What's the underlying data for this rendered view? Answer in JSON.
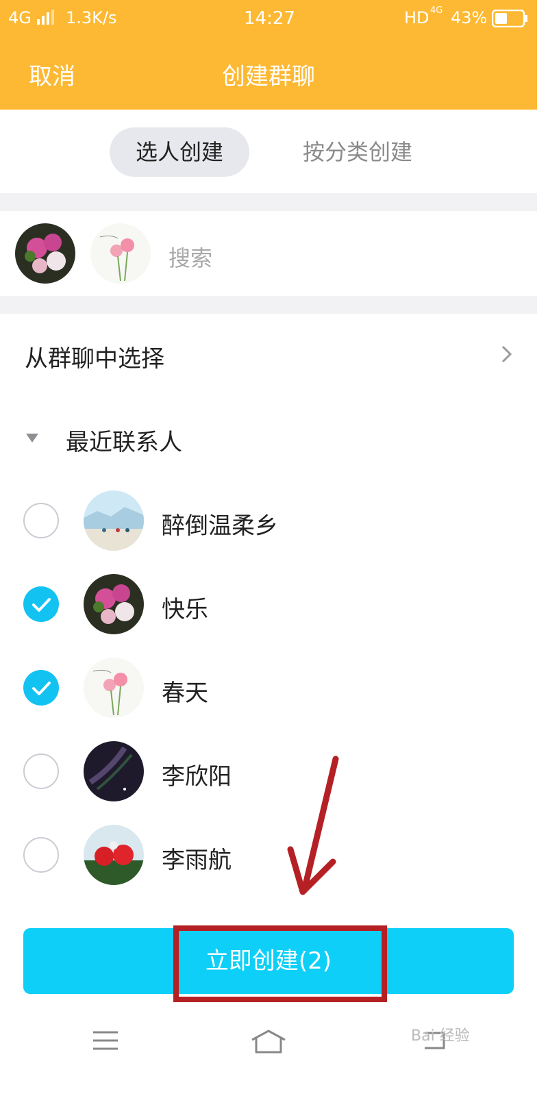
{
  "status_bar": {
    "network": "4G",
    "speed": "1.3K/s",
    "time": "14:27",
    "hd": "HD",
    "network_right": "4G",
    "battery": "43%"
  },
  "header": {
    "cancel_label": "取消",
    "title": "创建群聊"
  },
  "tabs": [
    {
      "label": "选人创建",
      "active": true
    },
    {
      "label": "按分类创建",
      "active": false
    }
  ],
  "search": {
    "placeholder": "搜索"
  },
  "from_group": {
    "label": "从群聊中选择"
  },
  "recent_section": {
    "label": "最近联系人"
  },
  "contacts": [
    {
      "name": "醉倒温柔乡",
      "checked": false
    },
    {
      "name": "快乐",
      "checked": true
    },
    {
      "name": "春天",
      "checked": true
    },
    {
      "name": "李欣阳",
      "checked": false
    },
    {
      "name": "李雨航",
      "checked": false
    }
  ],
  "create_button": {
    "label": "立即创建(2)"
  },
  "watermark": "Bai 经验",
  "colors": {
    "accent_orange": "#fdb933",
    "accent_cyan": "#0ecff7",
    "highlight_red": "#b52025"
  },
  "icons": [
    "menu-icon",
    "home-icon",
    "back-icon",
    "chevron-right-icon",
    "triangle-down-icon",
    "check-icon"
  ]
}
